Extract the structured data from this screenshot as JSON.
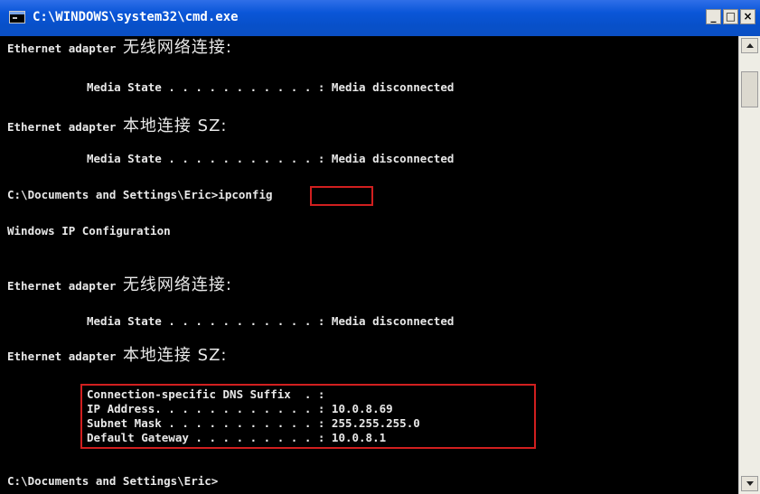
{
  "window": {
    "title": "C:\\WINDOWS\\system32\\cmd.exe",
    "controls": {
      "minimize": "_",
      "maximize": "□",
      "close": "×"
    }
  },
  "console": {
    "lines": [
      "Ethernet adapter ",
      "无线网络连接:",
      "Media State . . . . . . . . . . . : Media disconnected",
      "Ethernet adapter ",
      "本地连接 SZ:",
      "Media State . . . . . . . . . . . : Media disconnected",
      "C:\\Documents and Settings\\Eric>",
      "ipconfig",
      "Windows IP Configuration",
      "Ethernet adapter ",
      "无线网络连接:",
      "Media State . . . . . . . . . . . : Media disconnected",
      "Ethernet adapter ",
      "本地连接 SZ:",
      "Connection-specific DNS Suffix  . :",
      "IP Address. . . . . . . . . . . . : 10.0.8.69",
      "Subnet Mask . . . . . . . . . . . : 255.255.255.0",
      "Default Gateway . . . . . . . . . : 10.0.8.1",
      "C:\\Documents and Settings\\Eric>"
    ]
  },
  "colors": {
    "console_bg": "#000000",
    "console_text": "#e8e8e8",
    "highlight_border": "#d11f1f",
    "titlebar": "#0a56d8"
  },
  "icons": [
    "cmd-app-icon",
    "minimize-icon",
    "maximize-icon",
    "close-icon",
    "scroll-up-arrow",
    "scroll-down-arrow"
  ]
}
